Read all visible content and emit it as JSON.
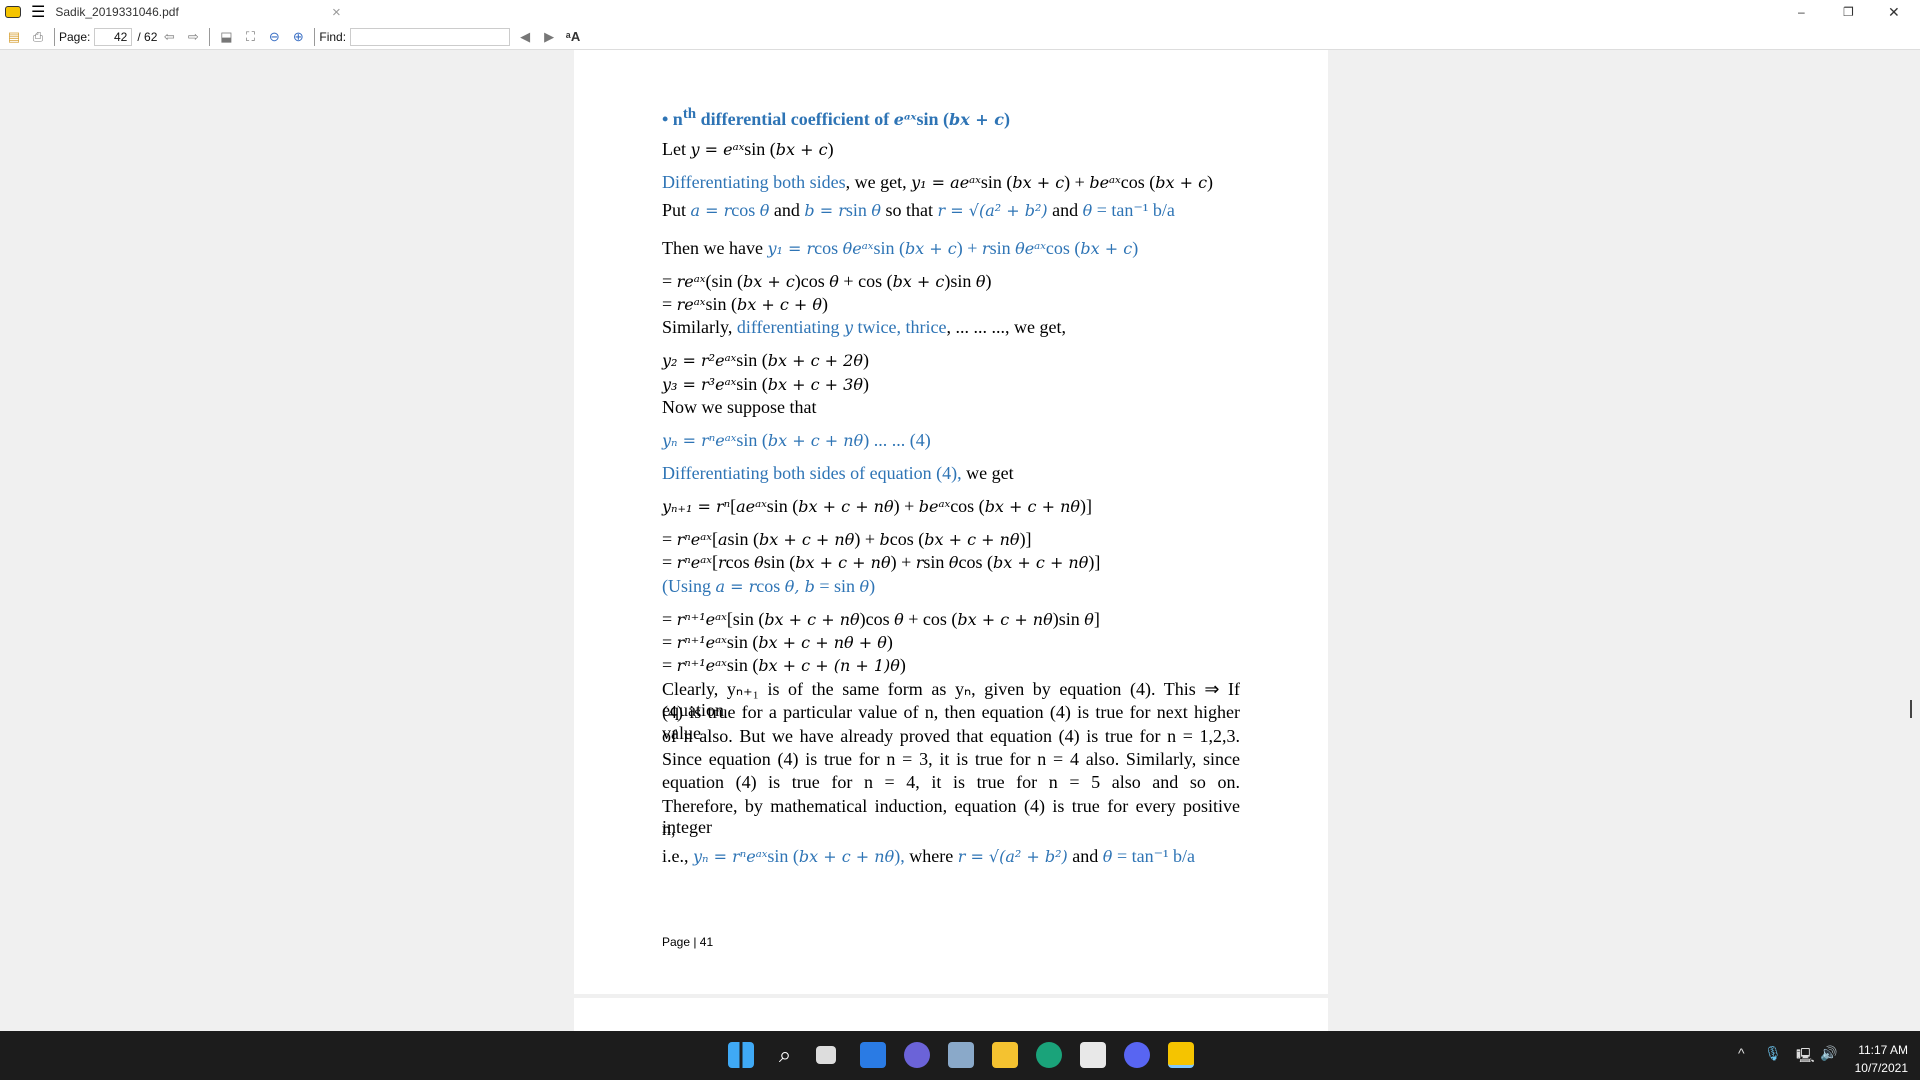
{
  "window": {
    "title": "Sadik_2019331046.pdf",
    "close": "×",
    "min": "–",
    "max": "❐",
    "x": "✕"
  },
  "toolbar": {
    "page_label": "Page:",
    "page_value": "42",
    "page_total": "/ 62",
    "find_label": "Find:",
    "find_value": ""
  },
  "document": {
    "lines": [
      {
        "cls": "h",
        "segs": [
          {
            "t": "•  n",
            "c": "b"
          },
          {
            "t": "th",
            "c": "b",
            "sup": 1
          },
          {
            "t": " differential coefficient of ",
            "c": "b"
          },
          {
            "t": "eᵃˣ",
            "c": "b",
            "m": 1
          },
          {
            "t": "sin (",
            "c": "b"
          },
          {
            "t": "bx + c",
            "c": "b",
            "m": 1
          },
          {
            "t": ")",
            "c": "b"
          }
        ]
      },
      {
        "segs": [
          {
            "t": "Let "
          },
          {
            "t": "y = eᵃˣ",
            "m": 1
          },
          {
            "t": "sin ("
          },
          {
            "t": "bx + c",
            "m": 1
          },
          {
            "t": ")"
          }
        ]
      },
      {
        "segs": [
          {
            "t": "Differentiating  both  sides",
            "c": "b"
          },
          {
            "t": ",  we  get,  "
          },
          {
            "t": "y₁ = aeᵃˣ",
            "m": 1
          },
          {
            "t": "sin ("
          },
          {
            "t": "bx + c",
            "m": 1
          },
          {
            "t": ") + "
          },
          {
            "t": "beᵃˣ",
            "m": 1
          },
          {
            "t": "cos ("
          },
          {
            "t": "bx + c",
            "m": 1
          },
          {
            "t": ")"
          }
        ]
      },
      {
        "segs": [
          {
            "t": "Put "
          },
          {
            "t": "a = r",
            "c": "b",
            "m": 1
          },
          {
            "t": "cos ",
            "c": "b"
          },
          {
            "t": "θ",
            "c": "b",
            "m": 1
          },
          {
            "t": " and "
          },
          {
            "t": "b = r",
            "c": "b",
            "m": 1
          },
          {
            "t": "sin ",
            "c": "b"
          },
          {
            "t": "θ",
            "c": "b",
            "m": 1
          },
          {
            "t": " so that "
          },
          {
            "t": "r = √(a² + b²)",
            "c": "b",
            "m": 1
          },
          {
            "t": " and "
          },
          {
            "t": "θ",
            "c": "b",
            "m": 1
          },
          {
            "t": " = tan⁻¹ b/a",
            "c": "b"
          }
        ]
      },
      {
        "segs": [
          {
            "t": "Then we have "
          },
          {
            "t": "y₁ = r",
            "c": "b",
            "m": 1
          },
          {
            "t": "cos ",
            "c": "b"
          },
          {
            "t": "θeᵃˣ",
            "c": "b",
            "m": 1
          },
          {
            "t": "sin (",
            "c": "b"
          },
          {
            "t": "bx + c",
            "c": "b",
            "m": 1
          },
          {
            "t": ") + ",
            "c": "b"
          },
          {
            "t": "r",
            "c": "b",
            "m": 1
          },
          {
            "t": "sin ",
            "c": "b"
          },
          {
            "t": "θeᵃˣ",
            "c": "b",
            "m": 1
          },
          {
            "t": "cos (",
            "c": "b"
          },
          {
            "t": "bx + c",
            "c": "b",
            "m": 1
          },
          {
            "t": ")",
            "c": "b"
          }
        ]
      },
      {
        "segs": [
          {
            "t": "= "
          },
          {
            "t": "reᵃˣ",
            "m": 1
          },
          {
            "t": "(sin ("
          },
          {
            "t": "bx + c",
            "m": 1
          },
          {
            "t": ")cos "
          },
          {
            "t": "θ",
            "m": 1
          },
          {
            "t": " + cos ("
          },
          {
            "t": "bx + c",
            "m": 1
          },
          {
            "t": ")sin "
          },
          {
            "t": "θ",
            "m": 1
          },
          {
            "t": ")"
          }
        ]
      },
      {
        "segs": [
          {
            "t": "= "
          },
          {
            "t": "reᵃˣ",
            "m": 1
          },
          {
            "t": "sin ("
          },
          {
            "t": "bx + c + θ",
            "m": 1
          },
          {
            "t": ")"
          }
        ]
      },
      {
        "segs": [
          {
            "t": "Similarly, "
          },
          {
            "t": "differentiating ",
            "c": "b"
          },
          {
            "t": "y",
            "c": "b",
            "m": 1
          },
          {
            "t": " twice, thrice",
            "c": "b"
          },
          {
            "t": ", ... ... ..., we get,"
          }
        ]
      },
      {
        "segs": [
          {
            "t": "y₂ = r²eᵃˣ",
            "m": 1
          },
          {
            "t": "sin ("
          },
          {
            "t": "bx + c + 2θ",
            "m": 1
          },
          {
            "t": ")"
          }
        ]
      },
      {
        "segs": [
          {
            "t": "y₃ = r³eᵃˣ",
            "m": 1
          },
          {
            "t": "sin ("
          },
          {
            "t": "bx + c + 3θ",
            "m": 1
          },
          {
            "t": ")"
          }
        ]
      },
      {
        "segs": [
          {
            "t": "Now we suppose that"
          }
        ]
      },
      {
        "segs": [
          {
            "t": "yₙ = rⁿeᵃˣ",
            "c": "b",
            "m": 1
          },
          {
            "t": "sin (",
            "c": "b"
          },
          {
            "t": "bx + c + nθ",
            "c": "b",
            "m": 1
          },
          {
            "t": ")  ... ... (4)",
            "c": "b"
          }
        ]
      },
      {
        "segs": [
          {
            "t": "Differentiating both sides of equation (4),",
            "c": "b"
          },
          {
            "t": " we get"
          }
        ]
      },
      {
        "segs": [
          {
            "t": "yₙ₊₁ = rⁿ",
            "m": 1
          },
          {
            "t": "["
          },
          {
            "t": "aeᵃˣ",
            "m": 1
          },
          {
            "t": "sin ("
          },
          {
            "t": "bx + c + nθ",
            "m": 1
          },
          {
            "t": ") + "
          },
          {
            "t": "beᵃˣ",
            "m": 1
          },
          {
            "t": "cos ("
          },
          {
            "t": "bx + c + nθ",
            "m": 1
          },
          {
            "t": ")]"
          }
        ]
      },
      {
        "segs": [
          {
            "t": "= "
          },
          {
            "t": "rⁿeᵃˣ",
            "m": 1
          },
          {
            "t": "["
          },
          {
            "t": "a",
            "m": 1
          },
          {
            "t": "sin ("
          },
          {
            "t": "bx + c + nθ",
            "m": 1
          },
          {
            "t": ") + "
          },
          {
            "t": "b",
            "m": 1
          },
          {
            "t": "cos ("
          },
          {
            "t": "bx + c + nθ",
            "m": 1
          },
          {
            "t": ")]"
          }
        ]
      },
      {
        "segs": [
          {
            "t": "= "
          },
          {
            "t": "rⁿeᵃˣ",
            "m": 1
          },
          {
            "t": "["
          },
          {
            "t": "r",
            "m": 1
          },
          {
            "t": "cos "
          },
          {
            "t": "θ",
            "m": 1
          },
          {
            "t": "sin ("
          },
          {
            "t": "bx + c + nθ",
            "m": 1
          },
          {
            "t": ") + "
          },
          {
            "t": "r",
            "m": 1
          },
          {
            "t": "sin "
          },
          {
            "t": "θ",
            "m": 1
          },
          {
            "t": "cos ("
          },
          {
            "t": "bx + c + nθ",
            "m": 1
          },
          {
            "t": ")]"
          }
        ]
      },
      {
        "segs": [
          {
            "t": "(Using ",
            "c": "b"
          },
          {
            "t": "a = r",
            "c": "b",
            "m": 1
          },
          {
            "t": "cos ",
            "c": "b"
          },
          {
            "t": "θ, b",
            "c": "b",
            "m": 1
          },
          {
            "t": " = sin ",
            "c": "b"
          },
          {
            "t": "θ",
            "c": "b",
            "m": 1
          },
          {
            "t": ")",
            "c": "b"
          }
        ]
      },
      {
        "segs": [
          {
            "t": "= "
          },
          {
            "t": "rⁿ⁺¹eᵃˣ",
            "m": 1
          },
          {
            "t": "[sin ("
          },
          {
            "t": "bx + c + nθ",
            "m": 1
          },
          {
            "t": ")cos "
          },
          {
            "t": "θ",
            "m": 1
          },
          {
            "t": " + cos ("
          },
          {
            "t": "bx + c + nθ",
            "m": 1
          },
          {
            "t": ")sin "
          },
          {
            "t": "θ",
            "m": 1
          },
          {
            "t": "]"
          }
        ]
      },
      {
        "segs": [
          {
            "t": "= "
          },
          {
            "t": "rⁿ⁺¹eᵃˣ",
            "m": 1
          },
          {
            "t": "sin ("
          },
          {
            "t": "bx + c + nθ + θ",
            "m": 1
          },
          {
            "t": ")"
          }
        ]
      },
      {
        "segs": [
          {
            "t": "= "
          },
          {
            "t": "rⁿ⁺¹eᵃˣ",
            "m": 1
          },
          {
            "t": "sin ("
          },
          {
            "t": "bx + c + (n + 1)θ",
            "m": 1
          },
          {
            "t": ")"
          }
        ]
      }
    ],
    "paragraph": [
      "Clearly, yₙ₊₁ is of the same form as yₙ, given by equation (4). This ⇒ If equation",
      "(4) is true for a particular value of n, then equation (4) is true for next higher value",
      "of n also. But we have already proved that equation (4) is true for n = 1,2,3.",
      "Since equation (4) is true for n = 3, it is true for n = 4 also. Similarly, since",
      "equation (4) is true for n = 4, it is true for n = 5 also and so on.",
      "Therefore, by mathematical induction, equation (4) is true for every positive integer"
    ],
    "last_word": "n,",
    "final": {
      "segs": [
        {
          "t": "i.e., "
        },
        {
          "t": "yₙ = rⁿeᵃˣ",
          "c": "b",
          "m": 1
        },
        {
          "t": "sin (",
          "c": "b"
        },
        {
          "t": "bx + c + nθ",
          "c": "b",
          "m": 1
        },
        {
          "t": "),",
          "c": "b"
        },
        {
          "t": " where "
        },
        {
          "t": "r = √(a² + b²)",
          "c": "b",
          "m": 1
        },
        {
          "t": " and "
        },
        {
          "t": "θ",
          "c": "b",
          "m": 1
        },
        {
          "t": " = tan⁻¹ b/a",
          "c": "b"
        }
      ]
    },
    "page_footer": "Page | 41"
  },
  "taskbar": {
    "time": "11:17 AM",
    "date": "10/7/2021"
  },
  "colors": {
    "accent": "#2e74b5"
  }
}
